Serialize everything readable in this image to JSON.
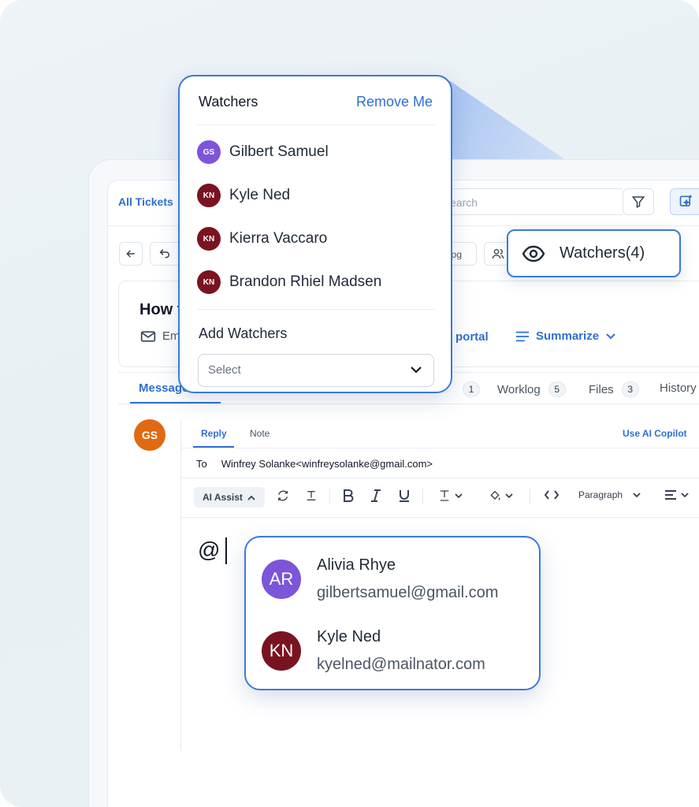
{
  "app": {
    "breadcrumb": "All Tickets",
    "search_placeholder": "Search",
    "search_visible_text": "earch",
    "toolbar_worklog": "log",
    "ticket_title": "How t",
    "ticket_channel": "Em",
    "customer_portal_link": "r portal",
    "summarize_label": "Summarize",
    "tabs": [
      {
        "label": "Message",
        "count": ""
      },
      {
        "label": "",
        "count": "1"
      },
      {
        "label": "Worklog",
        "count": "5"
      },
      {
        "label": "Files",
        "count": "3"
      },
      {
        "label": "History",
        "count": ""
      }
    ]
  },
  "message": {
    "author_initials": "GS",
    "reply_tab": "Reply",
    "note_tab": "Note",
    "copilot_link": "Use AI Copilot",
    "to_label": "To",
    "to_value": "Winfrey Solanke<winfreysolanke@gmail.com>",
    "ai_assist_label": "AI Assist",
    "paragraph_label": "Paragraph",
    "editor_text": "@"
  },
  "watchers_popover": {
    "title": "Watchers",
    "remove_label": "Remove Me",
    "watchers": [
      {
        "initials": "GS",
        "name": "Gilbert Samuel",
        "color": "#7c55d8"
      },
      {
        "initials": "KN",
        "name": "Kyle Ned",
        "color": "#7a1320"
      },
      {
        "initials": "KN",
        "name": "Kierra Vaccaro",
        "color": "#7a1320"
      },
      {
        "initials": "KN",
        "name": "Brandon Rhiel Madsen",
        "color": "#7a1320"
      }
    ],
    "add_label": "Add Watchers",
    "select_placeholder": "Select"
  },
  "watchers_chip": {
    "label": "Watchers(4)"
  },
  "mention_popover": {
    "users": [
      {
        "initials": "AR",
        "name": "Alivia Rhye",
        "email": "gilbertsamuel@gmail.com",
        "color": "#7c55d8"
      },
      {
        "initials": "KN",
        "name": "Kyle Ned",
        "email": "kyelned@mailnator.com",
        "color": "#7a1320"
      }
    ]
  },
  "colors": {
    "accent": "#2f6fd0",
    "highlight_border": "#3b7ad9",
    "author_avatar": "#e06a12"
  }
}
